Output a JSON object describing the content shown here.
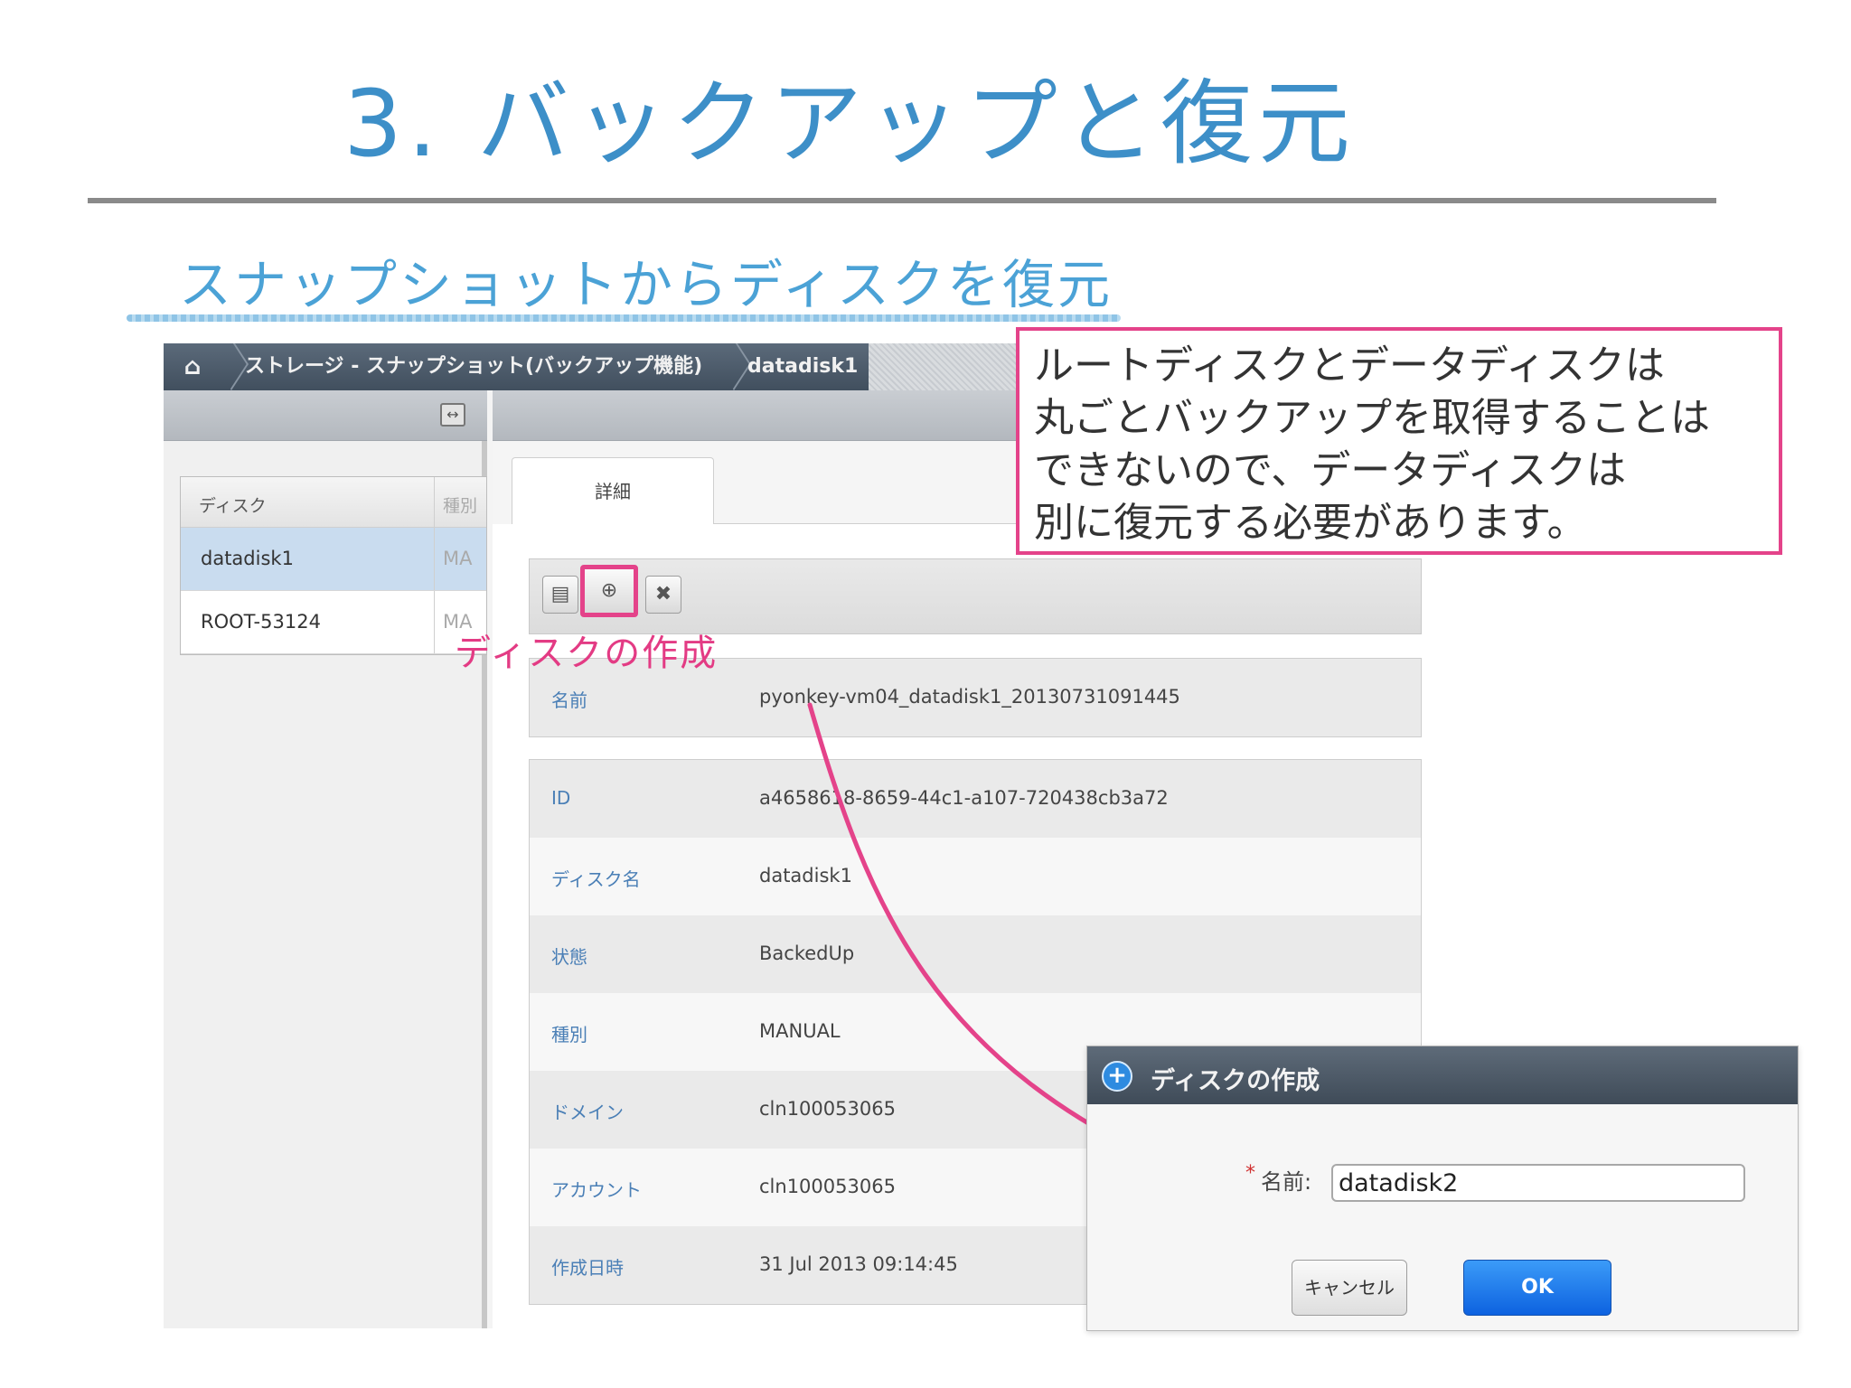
{
  "slide": {
    "title": "3. バックアップと復元",
    "subtitle": "スナップショットからディスクを復元"
  },
  "breadcrumb": {
    "home_icon": "home-icon",
    "items": [
      "ストレージ - スナップショット(バックアップ機能)",
      "datadisk1"
    ]
  },
  "disk_list": {
    "columns": [
      "ディスク",
      "種別"
    ],
    "rows": [
      {
        "name": "datadisk1",
        "type": "MA",
        "selected": true
      },
      {
        "name": "ROOT-53124",
        "type": "MA",
        "selected": false
      }
    ]
  },
  "detail": {
    "tab_label": "詳細",
    "action_icons": [
      "document-icon",
      "add-circle-icon",
      "close-icon"
    ],
    "action_label": "ディスクの作成",
    "name_row": {
      "key": "名前",
      "value": "pyonkey-vm04_datadisk1_20130731091445"
    },
    "properties": [
      {
        "key": "ID",
        "value": "a4658618-8659-44c1-a107-720438cb3a72"
      },
      {
        "key": "ディスク名",
        "value": "datadisk1"
      },
      {
        "key": "状態",
        "value": "BackedUp"
      },
      {
        "key": "種別",
        "value": "MANUAL"
      },
      {
        "key": "ドメイン",
        "value": "cln100053065"
      },
      {
        "key": "アカウント",
        "value": "cln100053065"
      },
      {
        "key": "作成日時",
        "value": "31 Jul 2013 09:14:45"
      }
    ]
  },
  "callout": {
    "lines": [
      "ルートディスクとデータディスクは",
      "丸ごとバックアップを取得することは",
      "できないので、データディスクは",
      "別に復元する必要があります。"
    ],
    "border_color": "#e4438a"
  },
  "dialog": {
    "title": "ディスクの作成",
    "name_label": "名前:",
    "required_mark": "*",
    "name_value": "datadisk2",
    "cancel_label": "キャンセル",
    "ok_label": "OK"
  },
  "colors": {
    "title": "#3d8fc8",
    "accent_pink": "#e4438a",
    "ok_button": "#1a75e8"
  }
}
